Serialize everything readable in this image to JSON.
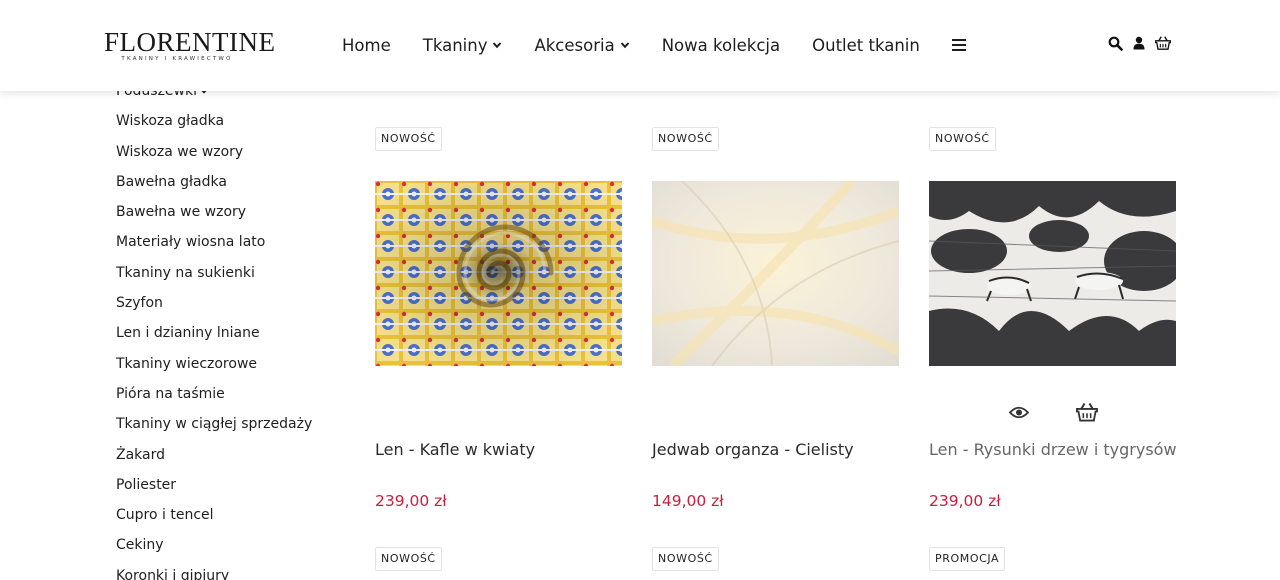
{
  "brand": {
    "name": "FLORENTINE",
    "tagline": "TKANINY I KRAWIECTWO"
  },
  "nav": {
    "items": [
      {
        "label": "Home",
        "has_dropdown": false
      },
      {
        "label": "Tkaniny",
        "has_dropdown": true
      },
      {
        "label": "Akcesoria",
        "has_dropdown": true
      },
      {
        "label": "Nowa kolekcja",
        "has_dropdown": false
      },
      {
        "label": "Outlet tkanin",
        "has_dropdown": false
      }
    ],
    "menu_icon": "hamburger-icon",
    "right_icons": [
      "search-icon",
      "user-icon",
      "basket-icon"
    ]
  },
  "sidebar": {
    "items": [
      {
        "label": "Poduszewki",
        "has_dropdown": true
      },
      {
        "label": "Wiskoza gładka"
      },
      {
        "label": "Wiskoza we wzory"
      },
      {
        "label": "Bawełna gładka"
      },
      {
        "label": "Bawełna we wzory"
      },
      {
        "label": "Materiały wiosna lato"
      },
      {
        "label": "Tkaniny na sukienki"
      },
      {
        "label": "Szyfon"
      },
      {
        "label": "Len i dzianiny lniane"
      },
      {
        "label": "Tkaniny wieczorowe"
      },
      {
        "label": "Pióra na taśmie"
      },
      {
        "label": "Tkaniny w ciągłej sprzedaży"
      },
      {
        "label": "Żakard"
      },
      {
        "label": "Poliester"
      },
      {
        "label": "Cupro i tencel"
      },
      {
        "label": "Cekiny"
      },
      {
        "label": "Koronki i gipiury"
      }
    ]
  },
  "products": [
    {
      "badge": "NOWOŚĆ",
      "name": "Len - Kafle w kwiaty",
      "price": "239,00 zł"
    },
    {
      "badge": "NOWOŚĆ",
      "name": "Jedwab organza - Cielisty",
      "price": "149,00 zł"
    },
    {
      "badge": "NOWOŚĆ",
      "name": "Len - Rysunki drzew i tygrysów",
      "price": "239,00 zł",
      "hovered": true
    }
  ],
  "next_row_badges": [
    "NOWOŚĆ",
    "NOWOŚĆ",
    "PROMOCJA"
  ],
  "colors": {
    "price": "#c4213f",
    "text": "#1f1f1f",
    "header_bg": "#ffffff"
  }
}
